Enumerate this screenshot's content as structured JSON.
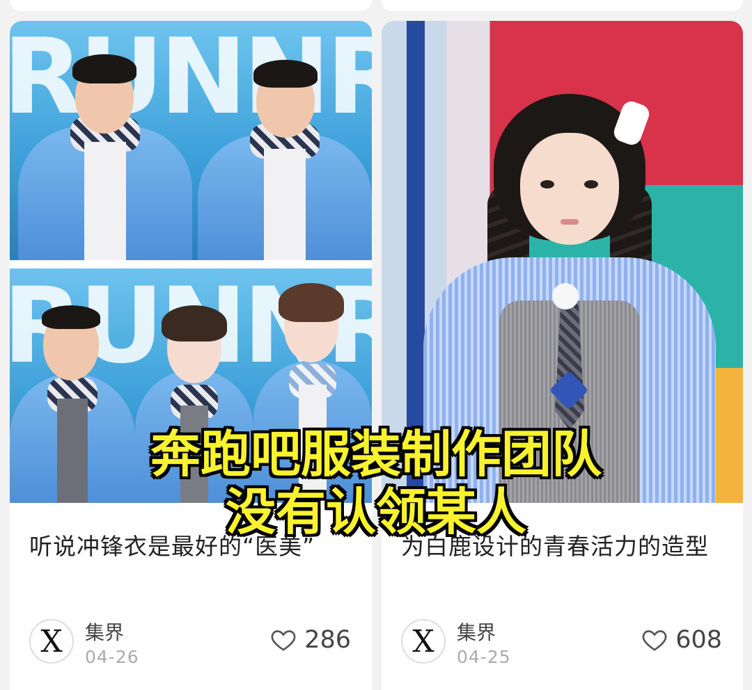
{
  "cards": [
    {
      "bg_text": "RUNNRUNN",
      "title": "听说冲锋衣是最好的“医美”",
      "author": "集界",
      "date": "04-26",
      "likes": "286"
    },
    {
      "title": "为白鹿设计的青春活力的造型",
      "author": "集界",
      "date": "04-25",
      "likes": "608"
    }
  ],
  "overlay": {
    "line1": "奔跑吧服装制作团队",
    "line2": "没有认领某人"
  },
  "avatar_glyph": "X",
  "colors": {
    "caption": "#f8f22f",
    "jacket": "#5e9ee0",
    "studio_red": "#d8334a"
  },
  "icons": {
    "likes": "heart-outline-icon",
    "avatar": "author-avatar"
  }
}
